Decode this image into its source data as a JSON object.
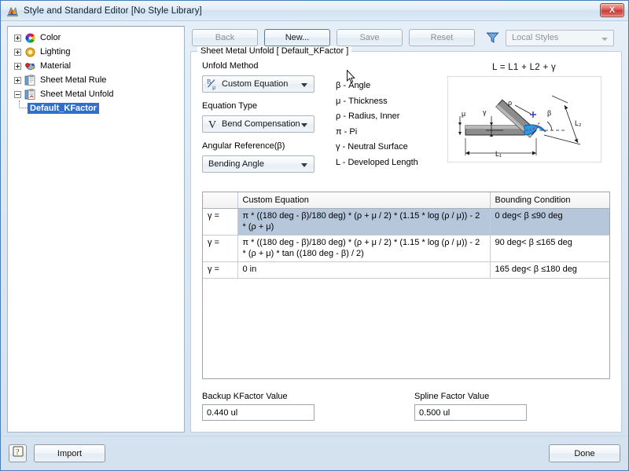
{
  "window": {
    "title": "Style and Standard Editor [No Style Library]",
    "icon": "style-editor-icon",
    "close_label": "X"
  },
  "tree": {
    "items": [
      {
        "label": "Color",
        "icon": "color-wheel-icon",
        "expander": "plus",
        "level": 0,
        "selected": false
      },
      {
        "label": "Lighting",
        "icon": "lighting-icon",
        "expander": "plus",
        "level": 0,
        "selected": false
      },
      {
        "label": "Material",
        "icon": "material-icon",
        "expander": "plus",
        "level": 0,
        "selected": false
      },
      {
        "label": "Sheet Metal Rule",
        "icon": "sheet-metal-rule-icon",
        "expander": "plus",
        "level": 0,
        "selected": false
      },
      {
        "label": "Sheet Metal Unfold",
        "icon": "sheet-metal-unfold-icon",
        "expander": "minus",
        "level": 0,
        "selected": false
      },
      {
        "label": "Default_KFactor",
        "icon": "none",
        "expander": "none",
        "level": 1,
        "selected": true
      }
    ]
  },
  "toolbar": {
    "back_label": "Back",
    "new_label": "New...",
    "save_label": "Save",
    "reset_label": "Reset",
    "filter_icon": "funnel-icon",
    "style_filter_value": "Local Styles"
  },
  "groupbox": {
    "title": "Sheet Metal Unfold [ Default_KFactor ]"
  },
  "controls": {
    "unfold_method_label": "Unfold Method",
    "unfold_method_value": "Custom Equation",
    "unfold_method_icon": "b-over-mu-icon",
    "equation_type_label": "Equation Type",
    "equation_type_value": "Bend Compensation",
    "equation_type_icon": "v-bend-icon",
    "angular_reference_label": "Angular Reference(β)",
    "angular_reference_value": "Bending Angle"
  },
  "legend": {
    "items": [
      "β - Angle",
      "μ - Thickness",
      "ρ - Radius, Inner",
      "π - Pi",
      "γ - Neutral Surface",
      "L - Developed Length"
    ]
  },
  "diagram": {
    "formula": "L = L1 + L2 + γ",
    "labels": {
      "thickness": "μ",
      "neutral": "γ",
      "radius": "ρ",
      "angle": "β",
      "leg1": "L₁",
      "leg2": "L₂"
    }
  },
  "table": {
    "headers": [
      "",
      "Custom Equation",
      "Bounding Condition"
    ],
    "rows": [
      {
        "var": "γ =",
        "equation": "π * ((180 deg - β)/180 deg) * (ρ + μ / 2) * (1.15 * log (ρ / μ)) - 2 * (ρ + μ)",
        "condition": "0 deg< β ≤90 deg",
        "selected": true
      },
      {
        "var": "γ =",
        "equation": "π * ((180 deg - β)/180 deg) * (ρ + μ / 2) * (1.15 * log (ρ / μ)) - 2 * (ρ + μ) * tan ((180 deg - β) / 2)",
        "condition": "90 deg< β ≤165 deg",
        "selected": false
      },
      {
        "var": "γ =",
        "equation": "0 in",
        "condition": "165 deg< β ≤180 deg",
        "selected": false
      }
    ]
  },
  "fields": {
    "backup_kfactor_label": "Backup KFactor Value",
    "backup_kfactor_value": "0.440 ul",
    "spline_factor_label": "Spline Factor Value",
    "spline_factor_value": "0.500 ul"
  },
  "footer": {
    "help_icon": "help-question-icon",
    "import_label": "Import",
    "done_label": "Done"
  },
  "colors": {
    "selection_blue": "#2f6fd0",
    "row_select": "#b6c7dc",
    "accent_blue": "#3d7fd0",
    "close_red": "#c93d39",
    "bend_highlight": "#2a9ae8"
  }
}
